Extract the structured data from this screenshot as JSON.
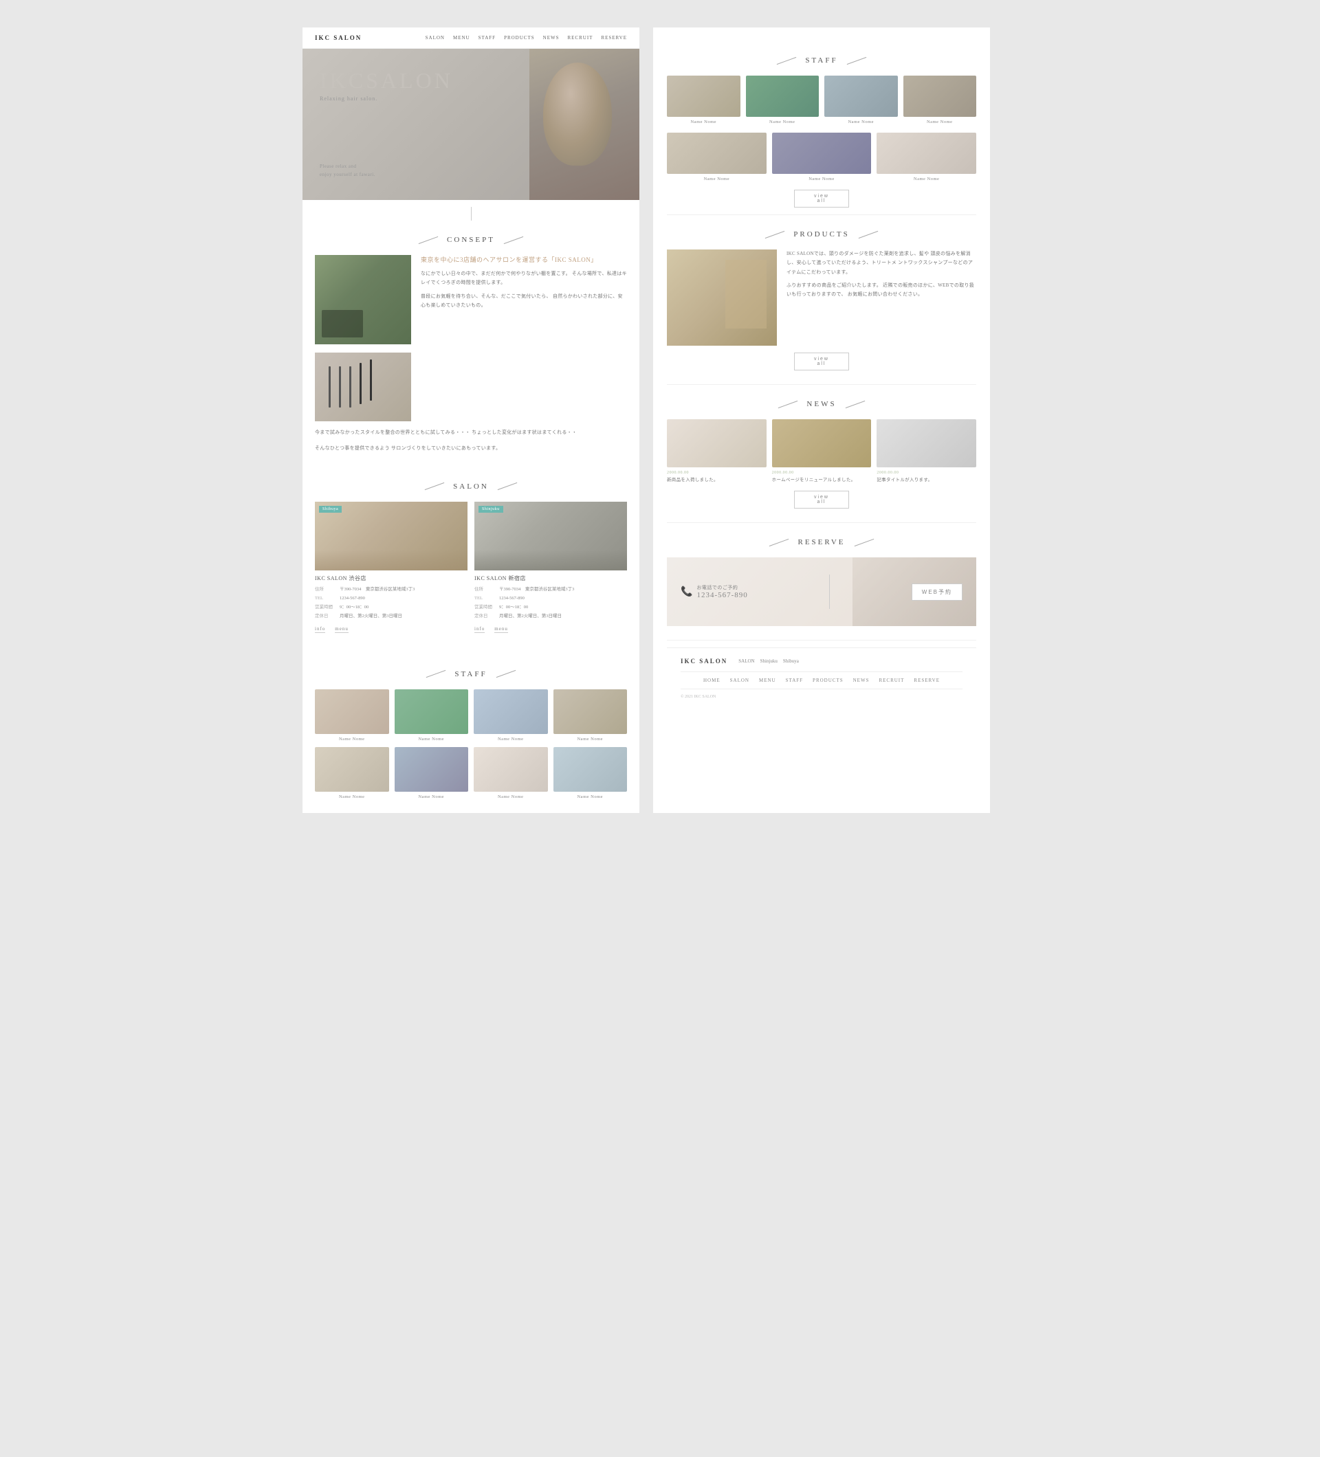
{
  "nav": {
    "logo": "IKC SALON",
    "items": [
      "SALON",
      "MENU",
      "STAFF",
      "PRODUCTS",
      "NEWS",
      "RECRUIT",
      "RESERVE"
    ]
  },
  "hero": {
    "title": "IKCSALON",
    "subtitle": "Relaxing hair salon.",
    "desc_line1": "Please relax and",
    "desc_line2": "enjoy yourself at fawari."
  },
  "consept": {
    "section_title": "CONSEPT",
    "heading": "東京を中心に3店舗のヘアサロンを運営する「IKC SALON」",
    "para1": "なにかでしい日々の中で、まだだ何かで何やりながい棚を置こす。\nそんな場所で、私達はキレイでくつろぎの時間を提供します。",
    "para2": "普段にお気軽を待ち合い、そんな、だここで気付いたら、\n自然らかわいされた部分に、安心も楽しめていきたいもの。",
    "lower_text1": "今まで試みなかったスタイルを整合の世界とともに試してみる・・・\nちょっとした変化がはます状はまてくれる・・",
    "lower_text2": "そんなひとつ事を提供できるよう\nサロンづくりをしていきたいにあもっています。"
  },
  "salon": {
    "section_title": "SALON",
    "locations": [
      {
        "tag": "Shibuya",
        "name": "IKC SALON 渋谷店",
        "address_label": "住所",
        "address": "〒390-7034　東京都渋谷区某地域3丁3",
        "tel_label": "TEL",
        "tel": "1234-567-890",
        "hours_label": "営業時間",
        "hours": "9：00〜18：00",
        "holiday_label": "定休日",
        "holiday": "月曜日、第2火曜日、第3日曜日",
        "link_info": "info",
        "link_menu": "menu"
      },
      {
        "tag": "Shinjuku",
        "name": "IKC SALON 新宿店",
        "address_label": "住所",
        "address": "〒390-7034　東京都渋谷区某地域3丁3",
        "tel_label": "TEL",
        "tel": "1234-567-890",
        "hours_label": "営業時間",
        "hours": "9：00〜18：00",
        "holiday_label": "定休日",
        "holiday": "月曜日、第2火曜日、第3日曜日",
        "link_info": "info",
        "link_menu": "menu"
      }
    ]
  },
  "staff_left": {
    "section_title": "STAFF",
    "members": [
      {
        "name": "Name Nome"
      },
      {
        "name": "Name Nome"
      },
      {
        "name": "Name Nome"
      },
      {
        "name": "Name Nome"
      },
      {
        "name": "Name Nome"
      },
      {
        "name": "Name Nome"
      },
      {
        "name": "Name Nome"
      },
      {
        "name": "Name Nome"
      }
    ]
  },
  "staff_right": {
    "section_title": "STAFF",
    "row1": [
      {
        "name": "Name Nome"
      },
      {
        "name": "Name Nome"
      },
      {
        "name": "Name Nome"
      },
      {
        "name": "Name Nome"
      }
    ],
    "row2": [
      {
        "name": "Name Nome"
      },
      {
        "name": "Name Nome"
      },
      {
        "name": "Name Nome"
      }
    ],
    "view_all": "view all"
  },
  "products": {
    "section_title": "PRODUCTS",
    "para1": "IKC SALONでは、頭りのダメージを防ぐた薬剤を追求し、髪や\n頭皮の悩みを解消し、安心して進っていただけるよう、トリートメ\nントワックスシャンプーなどのアイテムにこだわっています。",
    "para2": "ふりおすすめの商品をご紹介いたします。\n近隣での販売のほかに、WEBでの取り扱いも行っておりますので、\nお気軽にお問い合わせください。",
    "view_all": "view all"
  },
  "news": {
    "section_title": "NEWS",
    "items": [
      {
        "date": "2000.00.00",
        "caption": "新商品を入荷しました。"
      },
      {
        "date": "2000.00.00",
        "caption": "ホームページをリニューアルしました。"
      },
      {
        "date": "2000.00.00",
        "caption": "記事タイトルが入ります。"
      }
    ],
    "view_all": "view all"
  },
  "reserve": {
    "section_title": "RESERVE",
    "phone_label": "お電話でのご予約",
    "phone_number": "1234-567-890",
    "web_btn": "WEB予約"
  },
  "footer": {
    "logo": "IKC SALON",
    "locations": [
      "SALON",
      "Shinjuku",
      "Shibuya"
    ],
    "nav_items": [
      "HOME",
      "SALON",
      "MENU",
      "STAFF",
      "PRODUCTS",
      "NEWS",
      "RECRUIT",
      "RESERVE"
    ],
    "copyright": "© 2021 IKC SALON"
  }
}
